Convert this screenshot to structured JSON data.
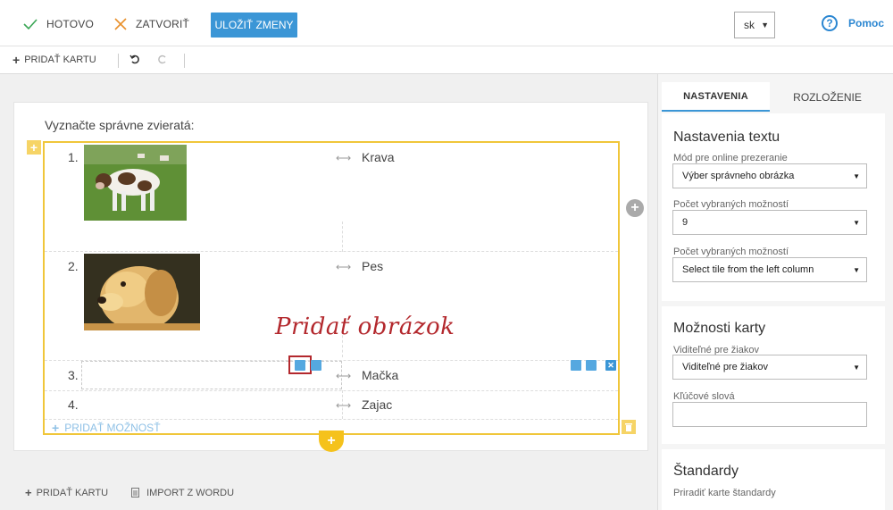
{
  "topbar": {
    "done_label": "HOTOVO",
    "close_label": "ZATVORIŤ",
    "save_label": "ULOŽIŤ ZMENY",
    "language": "sk",
    "help_label": "Pomoc"
  },
  "toolbar": {
    "add_card_label": "PRIDAŤ KARTU"
  },
  "editor": {
    "question": "Vyznačte správne zvieratá:",
    "rows": [
      {
        "number": "1.",
        "answer": "Krava"
      },
      {
        "number": "2.",
        "answer": "Pes"
      },
      {
        "number": "3.",
        "answer": "Mačka"
      },
      {
        "number": "4.",
        "answer": "Zajac"
      }
    ],
    "annotation": "Pridať obrázok",
    "add_option_label": "PRIDAŤ MOŽNOSŤ"
  },
  "footer": {
    "add_card_label": "PRIDAŤ KARTU",
    "import_label": "IMPORT Z WORDU"
  },
  "panel": {
    "tabs": [
      "NASTAVENIA",
      "ROZLOŽENIE"
    ],
    "text_settings": {
      "title": "Nastavenia textu",
      "mode_label": "Mód pre online prezeranie",
      "mode_value": "Výber správneho obrázka",
      "count_label": "Počet vybraných možností",
      "count_value": "9",
      "count2_label": "Počet vybraných možností",
      "count2_value": "Select tile from the left column"
    },
    "card_options": {
      "title": "Možnosti karty",
      "visible_label": "Viditeľné pre žiakov",
      "visible_value": "Viditeľné pre žiakov",
      "keywords_label": "Kľúčové slová",
      "keywords_value": ""
    },
    "standards": {
      "title": "Štandardy",
      "assign_label": "Priradiť karte štandardy"
    }
  },
  "colors": {
    "accent": "#3b96d6",
    "highlight": "#f0c63a",
    "annotation": "#b3282d"
  }
}
